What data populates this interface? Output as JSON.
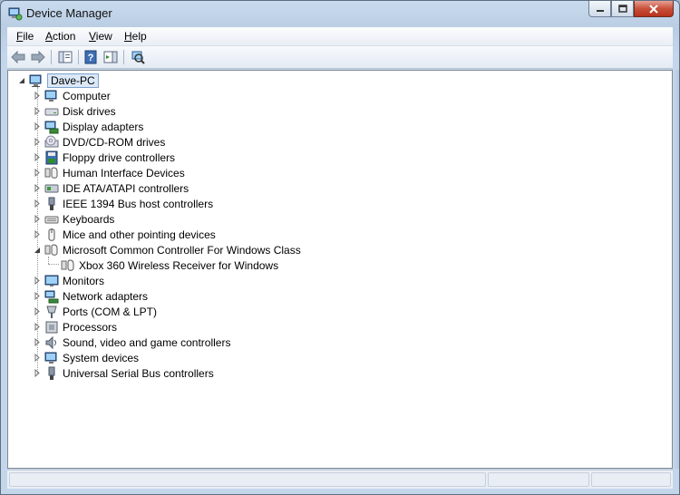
{
  "window": {
    "title": "Device Manager"
  },
  "menu": {
    "file": {
      "accel": "F",
      "rest": "ile"
    },
    "action": {
      "accel": "A",
      "rest": "ction"
    },
    "view": {
      "accel": "V",
      "rest": "iew"
    },
    "help": {
      "accel": "H",
      "rest": "elp"
    }
  },
  "toolbar": {
    "buttons": [
      "back-icon",
      "forward-icon",
      "properties-icon",
      "help-icon",
      "update-driver-icon",
      "scan-hardware-icon"
    ]
  },
  "tree": {
    "root": {
      "label": "Dave-PC",
      "icon": "computer-icon",
      "expanded": true
    },
    "categories": [
      {
        "label": "Computer",
        "icon": "computer-icon",
        "expanded": false
      },
      {
        "label": "Disk drives",
        "icon": "disk-drive-icon",
        "expanded": false
      },
      {
        "label": "Display adapters",
        "icon": "display-adapter-icon",
        "expanded": false
      },
      {
        "label": "DVD/CD-ROM drives",
        "icon": "dvd-drive-icon",
        "expanded": false
      },
      {
        "label": "Floppy drive controllers",
        "icon": "floppy-controller-icon",
        "expanded": false
      },
      {
        "label": "Human Interface Devices",
        "icon": "hid-icon",
        "expanded": false
      },
      {
        "label": "IDE ATA/ATAPI controllers",
        "icon": "ide-controller-icon",
        "expanded": false
      },
      {
        "label": "IEEE 1394 Bus host controllers",
        "icon": "firewire-icon",
        "expanded": false
      },
      {
        "label": "Keyboards",
        "icon": "keyboard-icon",
        "expanded": false
      },
      {
        "label": "Mice and other pointing devices",
        "icon": "mouse-icon",
        "expanded": false
      },
      {
        "label": "Microsoft Common Controller For Windows Class",
        "icon": "controller-class-icon",
        "expanded": true,
        "children": [
          {
            "label": "Xbox 360 Wireless Receiver for Windows",
            "icon": "controller-device-icon"
          }
        ]
      },
      {
        "label": "Monitors",
        "icon": "monitor-icon",
        "expanded": false
      },
      {
        "label": "Network adapters",
        "icon": "network-adapter-icon",
        "expanded": false
      },
      {
        "label": "Ports (COM & LPT)",
        "icon": "port-icon",
        "expanded": false
      },
      {
        "label": "Processors",
        "icon": "processor-icon",
        "expanded": false
      },
      {
        "label": "Sound, video and game controllers",
        "icon": "sound-icon",
        "expanded": false
      },
      {
        "label": "System devices",
        "icon": "system-device-icon",
        "expanded": false
      },
      {
        "label": "Universal Serial Bus controllers",
        "icon": "usb-icon",
        "expanded": false
      }
    ]
  },
  "colors": {
    "selection": "#dbe8f7",
    "selection_border": "#7da2ce",
    "window_frame": "#c4d6ea",
    "close_red": "#c8503a"
  }
}
